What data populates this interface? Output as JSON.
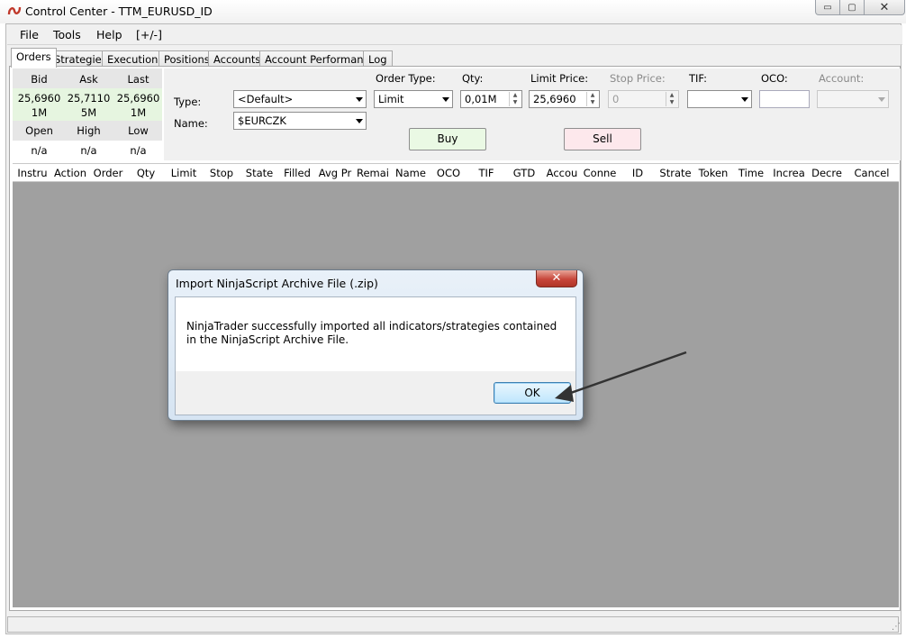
{
  "window": {
    "title": "Control Center - TTM_EURUSD_ID",
    "minimize": "▭",
    "maximize": "▢",
    "close": "✕"
  },
  "menu": [
    "File",
    "Tools",
    "Help",
    "[+/-]"
  ],
  "tabs": [
    "Orders",
    "Strategies",
    "Executions",
    "Positions",
    "Accounts",
    "Account Performance",
    "Log"
  ],
  "quote": {
    "headers1": [
      "Bid",
      "Ask",
      "Last"
    ],
    "prices": [
      "25,6960",
      "25,7110",
      "25,6960"
    ],
    "sizes": [
      "1M",
      "5M",
      "1M"
    ],
    "headers2": [
      "Open",
      "High",
      "Low"
    ],
    "values2": [
      "n/a",
      "n/a",
      "n/a"
    ]
  },
  "order_entry": {
    "type_label": "Type:",
    "type_value": "<Default>",
    "name_label": "Name:",
    "name_value": "$EURCZK",
    "order_type_label": "Order Type:",
    "order_type_value": "Limit",
    "qty_label": "Qty:",
    "qty_value": "0,01M",
    "limit_price_label": "Limit Price:",
    "limit_price_value": "25,6960",
    "stop_price_label": "Stop Price:",
    "stop_price_value": "0",
    "tif_label": "TIF:",
    "tif_value": "",
    "oco_label": "OCO:",
    "oco_value": "",
    "account_label": "Account:",
    "account_value": "",
    "buy_label": "Buy",
    "sell_label": "Sell"
  },
  "grid_columns": [
    "Instru",
    "Action",
    "Order",
    "Qty",
    "Limit",
    "Stop",
    "State",
    "Filled",
    "Avg Pr",
    "Remai",
    "Name",
    "OCO",
    "TIF",
    "GTD",
    "Accou",
    "Conne",
    "ID",
    "Strate",
    "Token",
    "Time",
    "Increa",
    "Decre",
    "Cancel"
  ],
  "dialog": {
    "title": "Import NinjaScript Archive File (.zip)",
    "close": "✕",
    "message": "NinjaTrader successfully imported all indicators/strategies contained in the NinjaScript Archive File.",
    "ok_label": "OK"
  },
  "colors": {
    "grid_bg": "#a0a0a0",
    "buy_bg": "#eaf9e4",
    "sell_bg": "#fde8ec",
    "arrow": "#333333"
  },
  "icons": {
    "app": "ninjatrader-logo-icon",
    "spin_up": "▲",
    "spin_down": "▼"
  }
}
